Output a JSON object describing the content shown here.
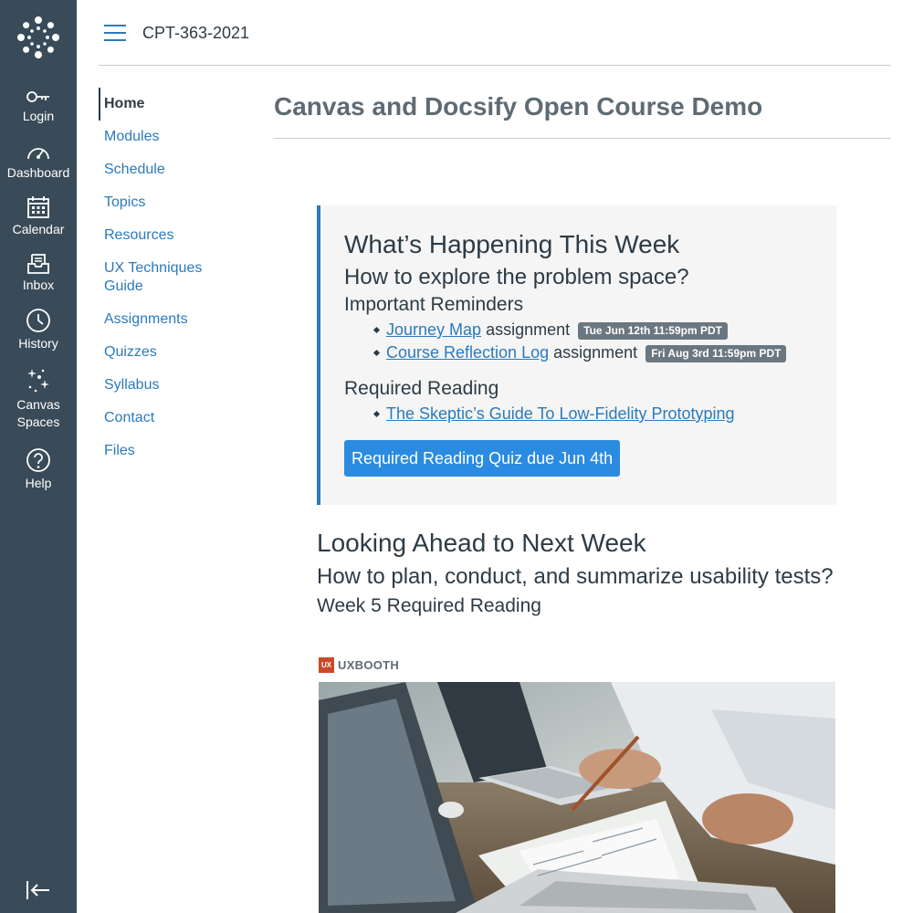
{
  "global_nav": {
    "items": [
      {
        "label": "Login",
        "icon": "key-icon"
      },
      {
        "label": "Dashboard",
        "icon": "dashboard-icon"
      },
      {
        "label": "Calendar",
        "icon": "calendar-icon"
      },
      {
        "label": "Inbox",
        "icon": "inbox-icon"
      },
      {
        "label": "History",
        "icon": "clock-icon"
      },
      {
        "label": "Canvas Spaces",
        "icon": "sparkles-icon"
      },
      {
        "label": "Help",
        "icon": "help-icon"
      }
    ],
    "colors": {
      "background": "#394b58",
      "text": "#ffffff"
    }
  },
  "header": {
    "breadcrumb": "CPT-363-2021"
  },
  "course_nav": {
    "items": [
      {
        "label": "Home",
        "active": true
      },
      {
        "label": "Modules"
      },
      {
        "label": "Schedule"
      },
      {
        "label": "Topics"
      },
      {
        "label": "Resources"
      },
      {
        "label": "UX Techniques Guide"
      },
      {
        "label": "Assignments"
      },
      {
        "label": "Quizzes"
      },
      {
        "label": "Syllabus"
      },
      {
        "label": "Contact"
      },
      {
        "label": "Files"
      }
    ]
  },
  "page": {
    "title": "Canvas and Docsify Open Course Demo"
  },
  "this_week": {
    "heading": "What’s Happening This Week",
    "question": "How to explore the problem space?",
    "reminders_heading": "Important Reminders",
    "reminders": [
      {
        "link": "Journey Map",
        "suffix": "assignment",
        "due": "Tue Jun 12th 11:59pm PDT"
      },
      {
        "link": "Course Reflection Log",
        "suffix": "assignment",
        "due": "Fri Aug 3rd 11:59pm PDT"
      }
    ],
    "reading_heading": "Required Reading",
    "reading_link": "The Skeptic’s Guide To Low-Fidelity Prototyping",
    "quiz_button": "Required Reading Quiz due Jun 4th"
  },
  "next_week": {
    "heading": "Looking Ahead to Next Week",
    "question": "How to plan, conduct, and summarize usability tests?",
    "reading_heading": "Week 5 Required Reading",
    "source_name": "UXBOOTH",
    "source_logo_text": "UX"
  },
  "colors": {
    "accent": "#2b7abc",
    "button": "#2b8be0",
    "callout_bg": "#f5f5f5",
    "badge": "#6b7780"
  }
}
